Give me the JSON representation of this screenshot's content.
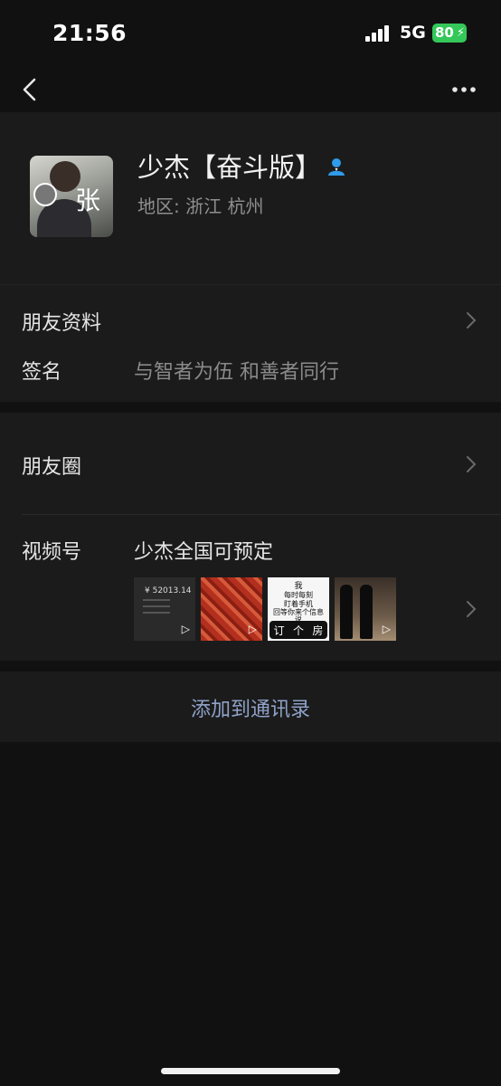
{
  "status_bar": {
    "time": "21:56",
    "network": "5G",
    "battery": "80"
  },
  "nav": {
    "back_icon": "chevron-left-icon",
    "more_icon": "more-horizontal-icon"
  },
  "profile": {
    "name": "少杰【奋斗版】",
    "region": "地区: 浙江 杭州",
    "avatar_char": "张",
    "verify_icon": "person-verified-icon",
    "verify_color": "#2f9bea"
  },
  "rows": {
    "friend_info": "朋友资料",
    "signature_label": "签名",
    "signature_value": "与智者为伍 和善者同行",
    "moments": "朋友圈",
    "channels_label": "视频号",
    "channels_value": "少杰全国可预定"
  },
  "thumbnails": {
    "t1_price": "¥ 52013.14",
    "t3_lines": [
      "我",
      "每时每刻",
      "盯着手机",
      "回等你来个信息",
      "说"
    ],
    "t3_bar": [
      "订",
      "个",
      "房"
    ]
  },
  "action": {
    "add_contact": "添加到通讯录",
    "color": "#8fa2c8"
  }
}
